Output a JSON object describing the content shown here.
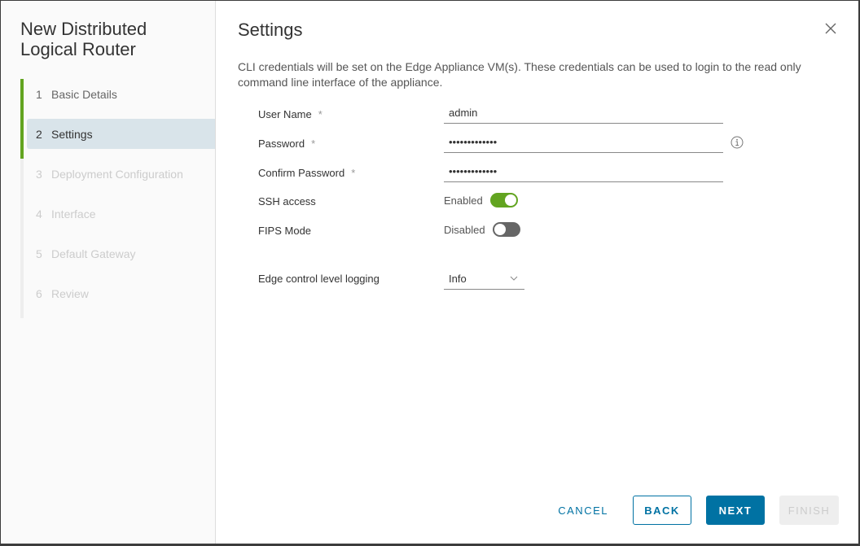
{
  "wizard": {
    "title": "New Distributed Logical Router",
    "steps": [
      {
        "num": "1",
        "label": "Basic Details",
        "state": "done"
      },
      {
        "num": "2",
        "label": "Settings",
        "state": "active"
      },
      {
        "num": "3",
        "label": "Deployment Configuration",
        "state": "pending"
      },
      {
        "num": "4",
        "label": "Interface",
        "state": "pending"
      },
      {
        "num": "5",
        "label": "Default Gateway",
        "state": "pending"
      },
      {
        "num": "6",
        "label": "Review",
        "state": "pending"
      }
    ]
  },
  "page": {
    "title": "Settings",
    "description": "CLI credentials will be set on the Edge Appliance VM(s). These credentials can be used to login to the read only command line interface of the appliance."
  },
  "form": {
    "required_marker": "*",
    "username": {
      "label": "User Name",
      "value": "admin"
    },
    "password": {
      "label": "Password",
      "value": "•••••••••••••"
    },
    "confirm_password": {
      "label": "Confirm Password",
      "value": "•••••••••••••"
    },
    "ssh": {
      "label": "SSH access",
      "state_label": "Enabled",
      "on": true
    },
    "fips": {
      "label": "FIPS Mode",
      "state_label": "Disabled",
      "on": false
    },
    "logging": {
      "label": "Edge control level logging",
      "value": "Info"
    }
  },
  "footer": {
    "cancel": "CANCEL",
    "back": "BACK",
    "next": "NEXT",
    "finish": "FINISH"
  },
  "colors": {
    "accent": "#0072a3",
    "success": "#62a420",
    "active_step_bg": "#d9e4ea"
  }
}
